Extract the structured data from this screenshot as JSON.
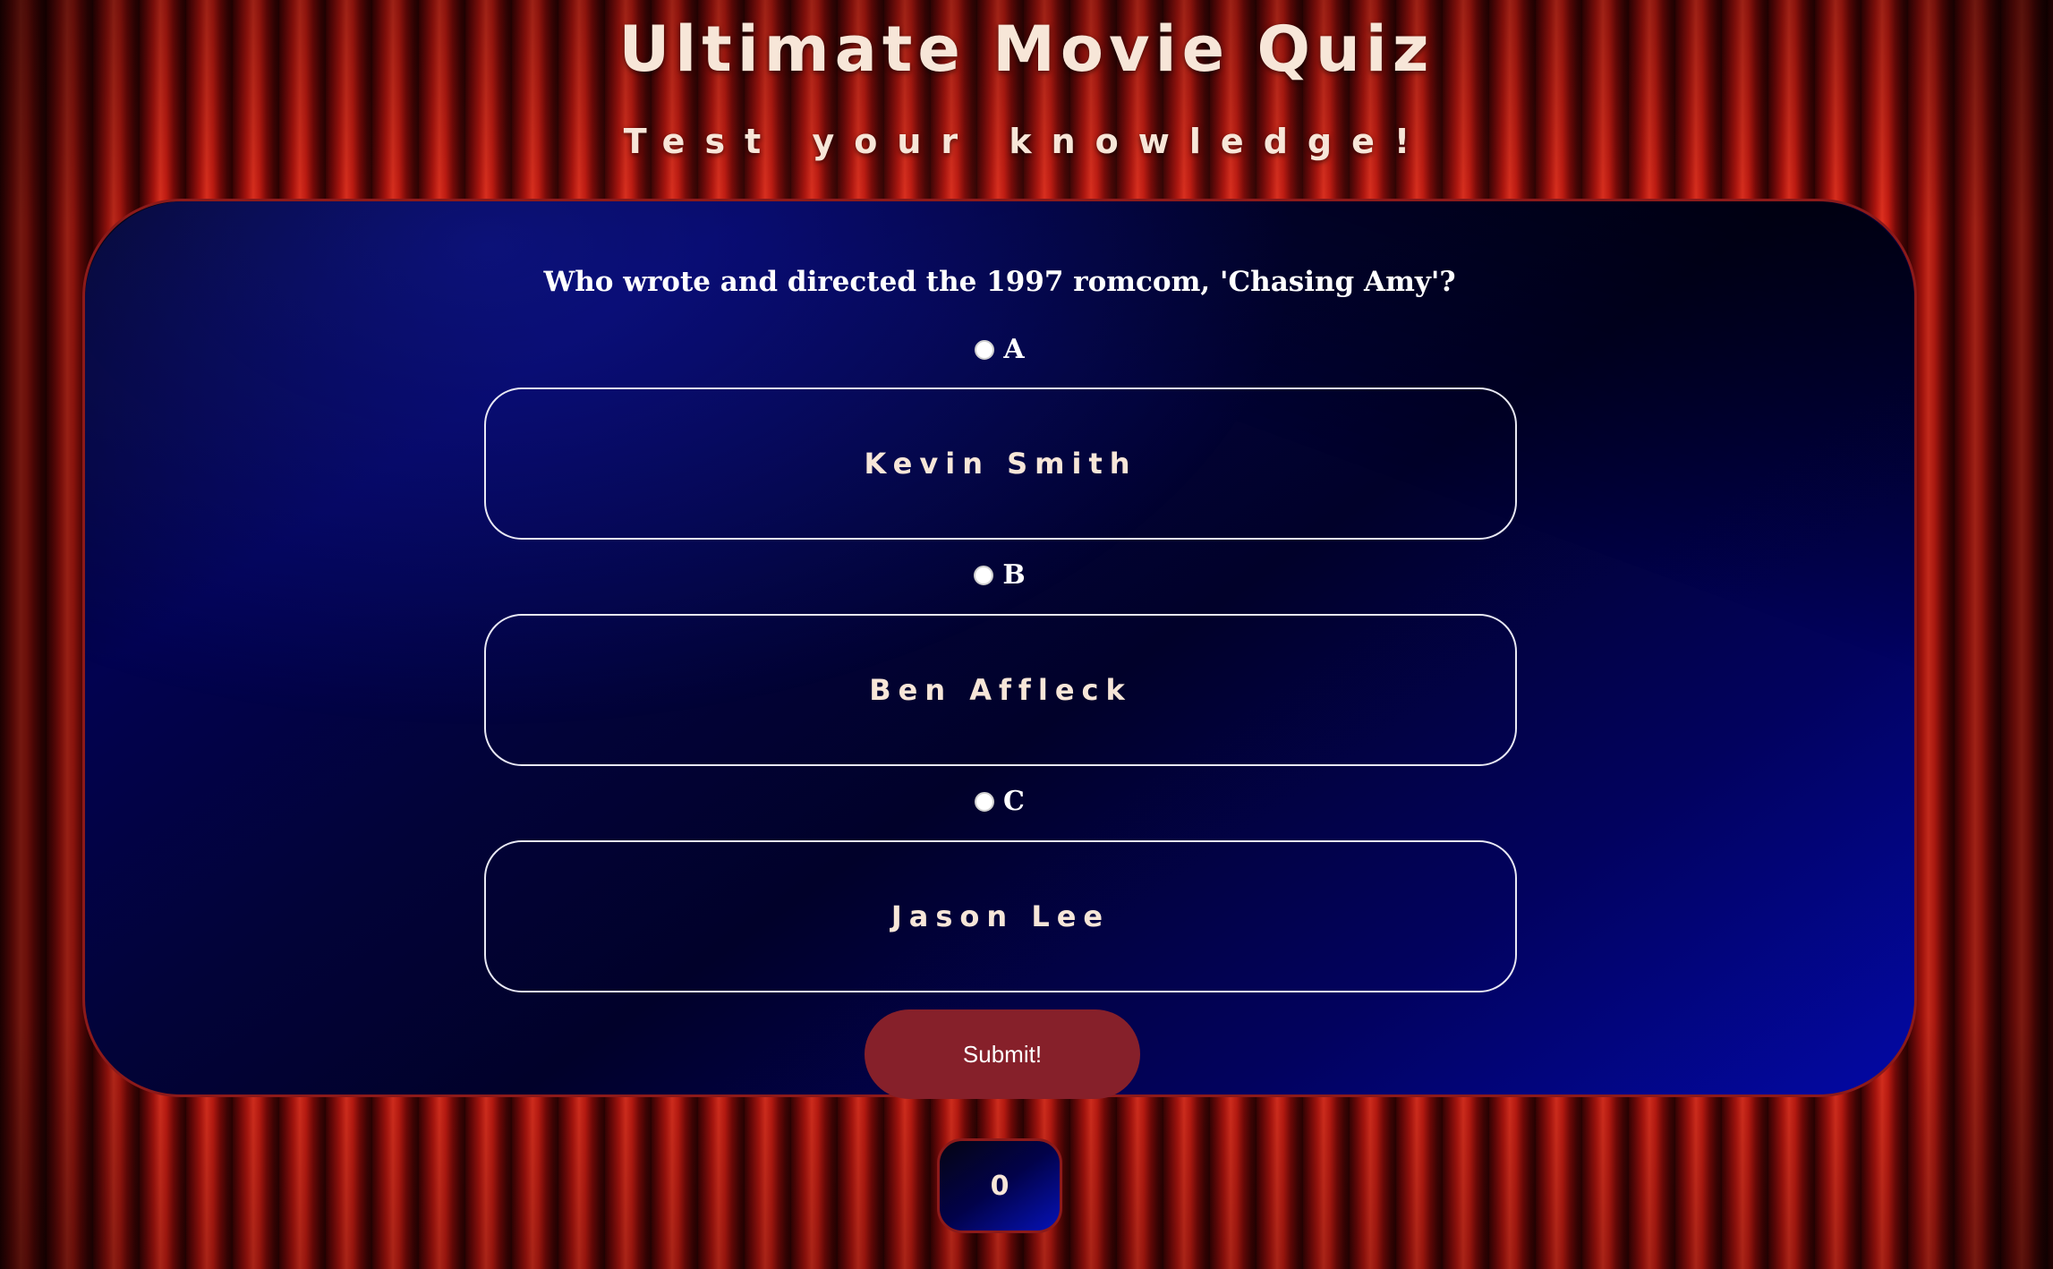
{
  "header": {
    "title": "Ultimate Movie Quiz",
    "subtitle": "Test your knowledge!"
  },
  "quiz": {
    "question": "Who wrote and directed the 1997 romcom, 'Chasing Amy'?",
    "options": [
      {
        "label": "A",
        "answer": "Kevin Smith",
        "selected": false
      },
      {
        "label": "B",
        "answer": "Ben Affleck",
        "selected": false
      },
      {
        "label": "C",
        "answer": "Jason Lee",
        "selected": false
      }
    ],
    "submit_label": "Submit!"
  },
  "score": {
    "value": "0"
  },
  "colors": {
    "panel_border": "#8c1a1a",
    "submit_bg": "#86202a",
    "title_text": "#f7e6d8",
    "panel_blue": "#0309a6"
  }
}
